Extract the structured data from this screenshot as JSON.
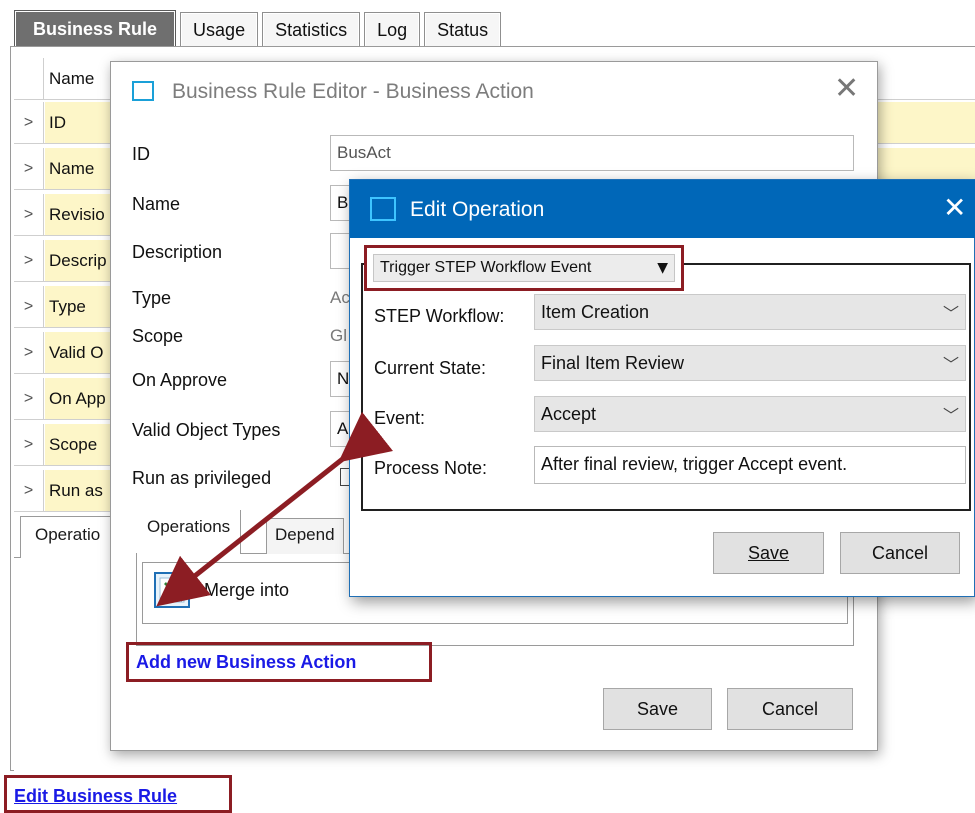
{
  "tabs": [
    {
      "label": "Business Rule",
      "active": true
    },
    {
      "label": "Usage",
      "active": false
    },
    {
      "label": "Statistics",
      "active": false
    },
    {
      "label": "Log",
      "active": false
    },
    {
      "label": "Status",
      "active": false
    }
  ],
  "props_table": {
    "header": "Name",
    "rows": [
      "ID",
      "Name",
      "Revisio",
      "Descrip",
      "Type",
      "Valid O",
      "On App",
      "Scope",
      "Run as"
    ],
    "expander": ">"
  },
  "lower_tab": "Operatio",
  "edit_rule_link": "Edit Business Rule",
  "editor": {
    "title": "Business Rule Editor - Business Action",
    "close": "✕",
    "fields": {
      "id_label": "ID",
      "id_value": "BusAct",
      "name_label": "Name",
      "name_value": "B",
      "description_label": "Description",
      "type_label": "Type",
      "type_value": "Ac",
      "scope_label": "Scope",
      "scope_value": "Gl",
      "on_approve_label": "On Approve",
      "on_approve_value": "N",
      "valid_object_types_label": "Valid Object Types",
      "valid_object_types_value": "A",
      "run_as_privileged_label": "Run as privileged"
    },
    "ops_tabs": [
      "Operations",
      "Depend"
    ],
    "merge_label": "Merge  into",
    "add_link": "Add new Business Action",
    "save": "Save",
    "cancel": "Cancel"
  },
  "edit_operation": {
    "title": "Edit Operation",
    "close": "✕",
    "operation_type": "Trigger STEP Workflow Event",
    "dropdown_arrow": "▼",
    "chevron": "﹀",
    "fields": {
      "workflow_label": "STEP Workflow:",
      "workflow_value": "Item Creation",
      "state_label": "Current State:",
      "state_value": "Final Item Review",
      "event_label": "Event:",
      "event_value": "Accept",
      "note_label": "Process Note:",
      "note_value": "After final review, trigger Accept event."
    },
    "save": "Save",
    "cancel": "Cancel"
  },
  "colors": {
    "highlight_box": "#8c1d23",
    "titlebar": "#0067b8",
    "link": "#1a1ae6",
    "row_fill": "#fdf6c8",
    "arrow": "#8c1d23"
  }
}
